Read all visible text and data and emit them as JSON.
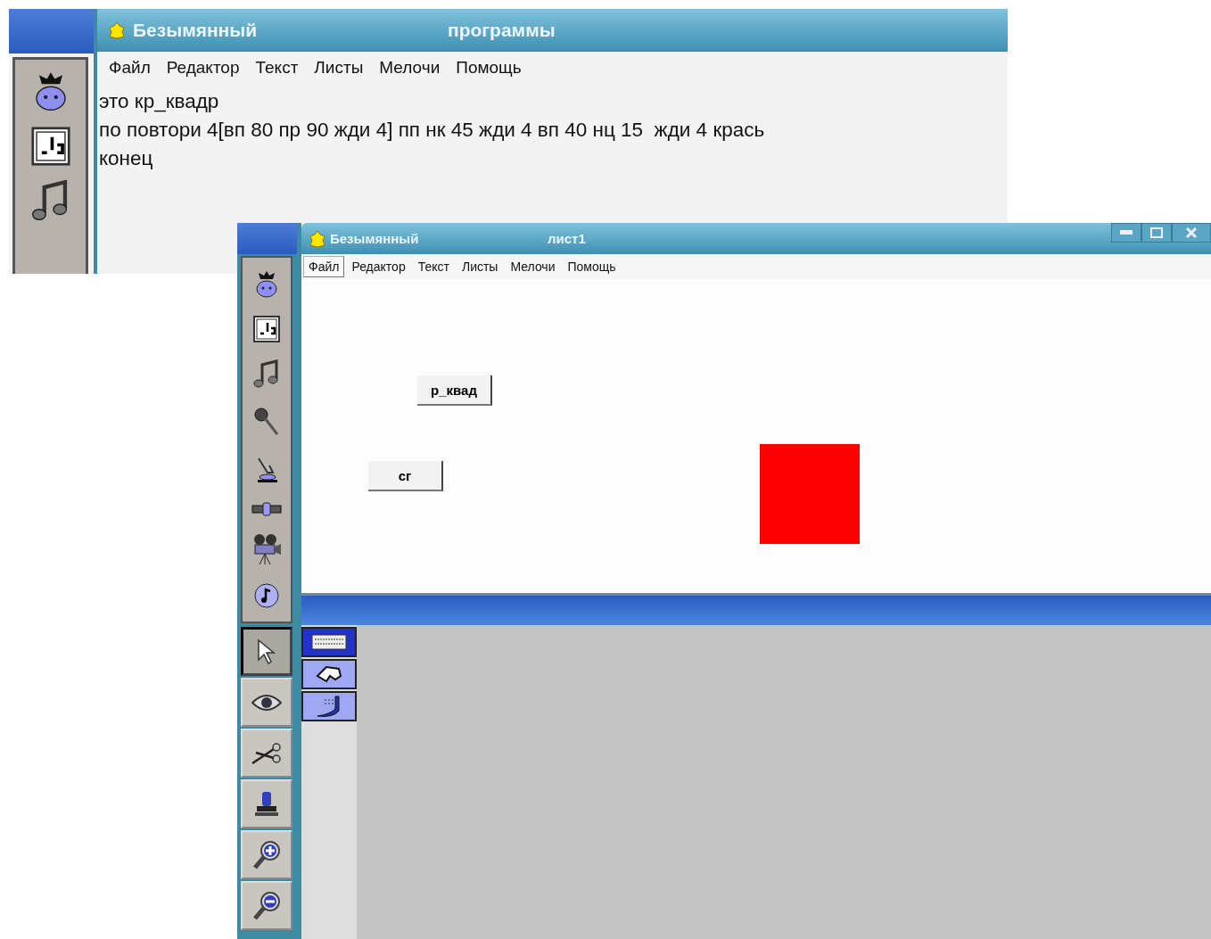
{
  "procedures_window": {
    "title": "Безымянный",
    "subtitle": "программы",
    "menu": [
      {
        "label": "Файл",
        "selected": false
      },
      {
        "label": "Редактор",
        "selected": false
      },
      {
        "label": "Текст",
        "selected": false
      },
      {
        "label": "Листы",
        "selected": false
      },
      {
        "label": "Мелочи",
        "selected": false
      },
      {
        "label": "Помощь",
        "selected": false
      }
    ],
    "tools": [
      {
        "kind": "turtle",
        "selected": false
      },
      {
        "kind": "text",
        "selected": false
      },
      {
        "kind": "music",
        "selected": false
      }
    ],
    "code_lines": [
      "это кр_квадр",
      "по повтори 4[вп 80 пр 90 жди 4] пп нк 45 жди 4 вп 40 нц 15  жди 4 крась",
      "конец"
    ]
  },
  "page_window": {
    "title": "Безымянный",
    "subtitle": "лист1",
    "menu": [
      {
        "label": "Файл",
        "selected": true
      },
      {
        "label": "Редактор",
        "selected": false
      },
      {
        "label": "Текст",
        "selected": false
      },
      {
        "label": "Листы",
        "selected": false
      },
      {
        "label": "Мелочи",
        "selected": false
      },
      {
        "label": "Помощь",
        "selected": false
      }
    ],
    "tools": [
      {
        "kind": "turtle",
        "selected": false
      },
      {
        "kind": "text",
        "selected": false
      },
      {
        "kind": "music",
        "selected": false
      },
      {
        "kind": "microphone",
        "selected": false
      },
      {
        "kind": "hand",
        "selected": false
      },
      {
        "kind": "slider",
        "selected": false
      },
      {
        "kind": "camera",
        "selected": false
      },
      {
        "kind": "melody",
        "selected": false
      }
    ],
    "actions": [
      {
        "kind": "pointer",
        "selected": true
      },
      {
        "kind": "eye",
        "selected": false
      },
      {
        "kind": "scissors",
        "selected": false
      },
      {
        "kind": "stamp",
        "selected": false
      },
      {
        "kind": "zoom_in",
        "selected": false
      },
      {
        "kind": "zoom_out",
        "selected": false
      }
    ],
    "canvas_buttons": [
      {
        "label": "р_квад"
      },
      {
        "label": "сг"
      }
    ],
    "shapes": [
      {
        "kind": "square",
        "color": "#ff0000"
      }
    ],
    "bottom_tabs": [
      {
        "kind": "text",
        "selected": true
      },
      {
        "kind": "shapes",
        "selected": false
      },
      {
        "kind": "brush",
        "selected": false
      }
    ]
  }
}
